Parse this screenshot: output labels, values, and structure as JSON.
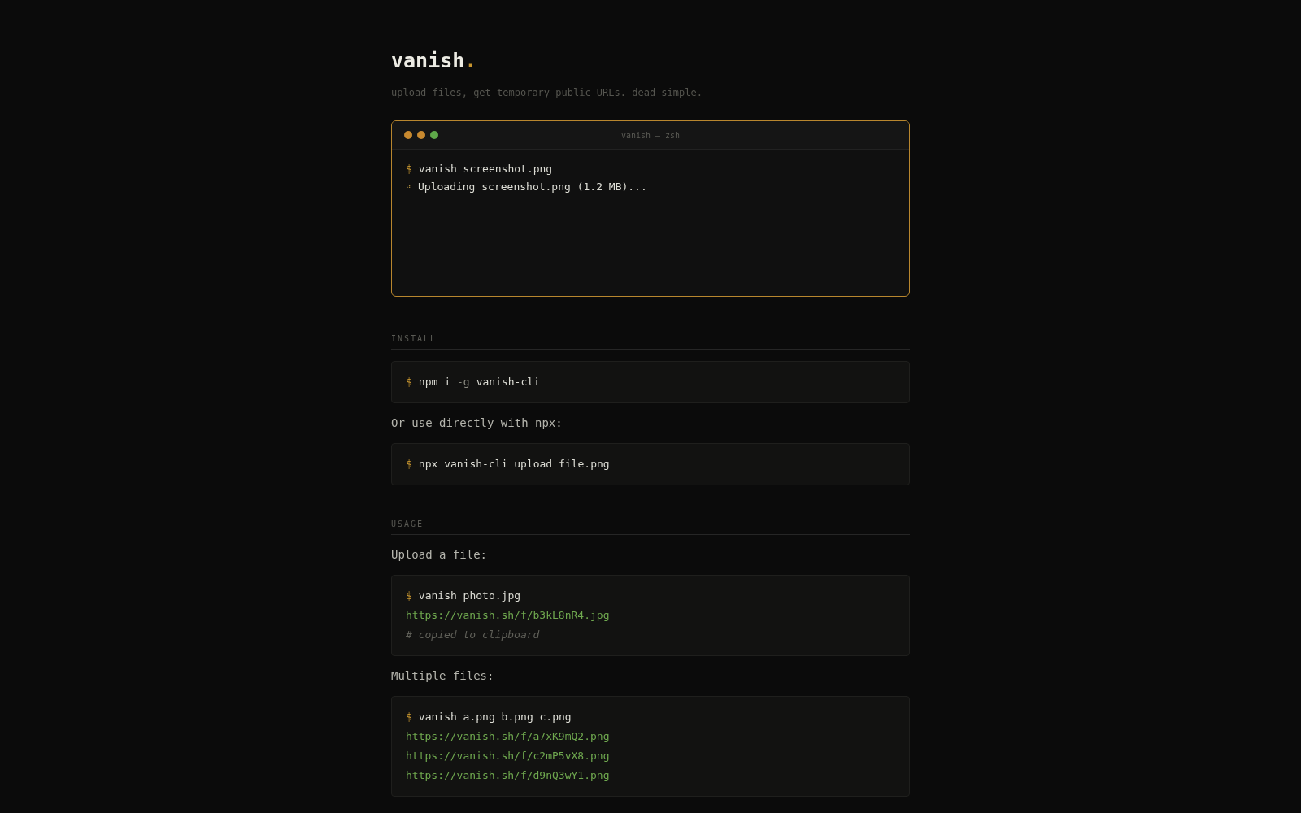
{
  "header": {
    "title": "vanish",
    "title_mark": ".",
    "tagline": "upload files, get temporary public URLs. dead simple."
  },
  "terminal": {
    "title": "vanish — zsh",
    "lights": [
      {
        "color": "#c8892f"
      },
      {
        "color": "#c8892f"
      },
      {
        "color": "#5fa84a"
      }
    ],
    "lines": [
      {
        "kind": "command",
        "prompt": "$",
        "parts": [
          {
            "text": "vanish screenshot.png"
          }
        ]
      },
      {
        "kind": "progress",
        "spinner": "⠴",
        "text": "Uploading screenshot.png (1.2 MB)..."
      }
    ]
  },
  "sections": [
    {
      "heading": "INSTALL",
      "items": [
        {
          "kind": "code",
          "lines": [
            {
              "kind": "command",
              "prompt": "$",
              "parts": [
                {
                  "text": "npm i"
                },
                {
                  "text": "-g",
                  "flag": true
                },
                {
                  "text": "vanish-cli"
                }
              ]
            }
          ]
        },
        {
          "kind": "text",
          "text": "Or use directly with npx:"
        },
        {
          "kind": "code",
          "lines": [
            {
              "kind": "command",
              "prompt": "$",
              "parts": [
                {
                  "text": "npx vanish-cli upload file.png"
                }
              ]
            }
          ]
        }
      ]
    },
    {
      "heading": "USAGE",
      "items": [
        {
          "kind": "text",
          "text": "Upload a file:"
        },
        {
          "kind": "code",
          "lines": [
            {
              "kind": "command",
              "prompt": "$",
              "parts": [
                {
                  "text": "vanish photo.jpg"
                }
              ]
            },
            {
              "kind": "url",
              "text": "https://vanish.sh/f/b3kL8nR4.jpg"
            },
            {
              "kind": "comment",
              "text": "# copied to clipboard"
            }
          ]
        },
        {
          "kind": "text",
          "text": "Multiple files:"
        },
        {
          "kind": "code",
          "lines": [
            {
              "kind": "command",
              "prompt": "$",
              "parts": [
                {
                  "text": "vanish a.png b.png c.png"
                }
              ]
            },
            {
              "kind": "url",
              "text": "https://vanish.sh/f/a7xK9mQ2.png"
            },
            {
              "kind": "url",
              "text": "https://vanish.sh/f/c2mP5vX8.png"
            },
            {
              "kind": "url",
              "text": "https://vanish.sh/f/d9nQ3wY1.png"
            }
          ]
        }
      ]
    }
  ]
}
